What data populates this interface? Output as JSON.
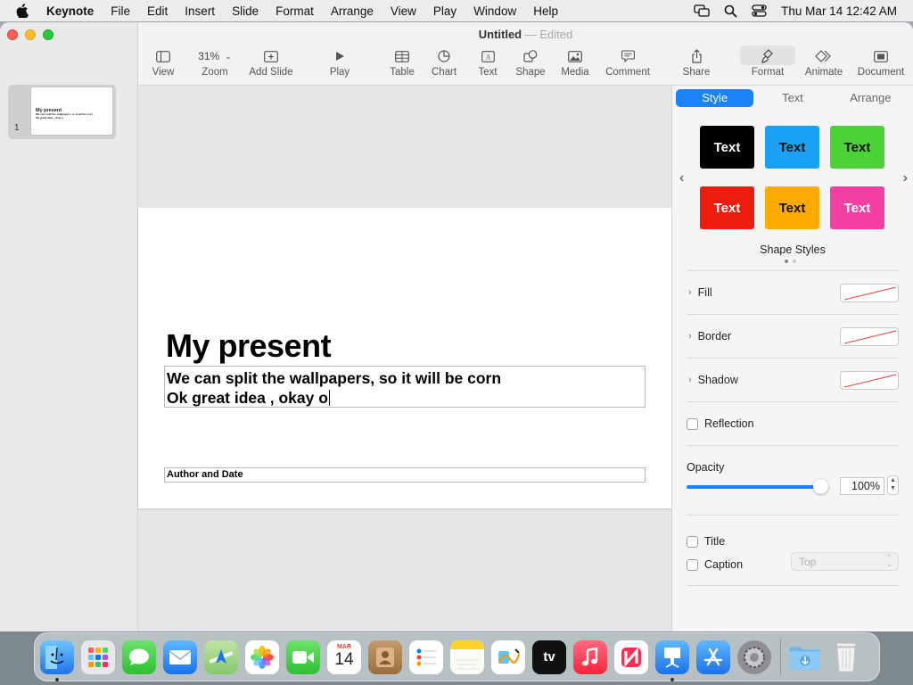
{
  "menubar": {
    "items": [
      "Keynote",
      "File",
      "Edit",
      "Insert",
      "Slide",
      "Format",
      "Arrange",
      "View",
      "Play",
      "Window",
      "Help"
    ],
    "clock": "Thu Mar 14  12:42 AM"
  },
  "window": {
    "title": "Untitled",
    "title_sep": "—",
    "status": "Edited"
  },
  "toolbar": {
    "zoom_value": "31%",
    "items": [
      "View",
      "Zoom",
      "Add Slide",
      "Play",
      "Table",
      "Chart",
      "Text",
      "Shape",
      "Media",
      "Comment",
      "Share",
      "Format",
      "Animate",
      "Document"
    ]
  },
  "navigator": {
    "slide_number": "1",
    "thumb_title": "My present",
    "thumb_line1": "We can split the wallpapers, so it will be corn",
    "thumb_line2": "Ok great idea , okay o"
  },
  "slide": {
    "title": "My present",
    "body_line1": "We can split the wallpapers, so it will be corn",
    "body_line2": "Ok great idea , okay o",
    "author": "Author and Date"
  },
  "inspector": {
    "tabs": [
      "Style",
      "Text",
      "Arrange"
    ],
    "active_tab": "Style",
    "shape_styles": [
      {
        "label": "Text",
        "bg": "#000000",
        "fg": "#ffffff"
      },
      {
        "label": "Text",
        "bg": "#1aa1f5",
        "fg": "#111111"
      },
      {
        "label": "Text",
        "bg": "#4cd137",
        "fg": "#111111"
      },
      {
        "label": "Text",
        "bg": "#ec1d0c",
        "fg": "#ffffff"
      },
      {
        "label": "Text",
        "bg": "#ffaa00",
        "fg": "#111111"
      },
      {
        "label": "Text",
        "bg": "#f43fa2",
        "fg": "#ffffff"
      }
    ],
    "shape_styles_label": "Shape Styles",
    "fill_label": "Fill",
    "border_label": "Border",
    "shadow_label": "Shadow",
    "reflection_label": "Reflection",
    "opacity_label": "Opacity",
    "opacity_value": "100%",
    "opacity_level": 1.0,
    "title_label": "Title",
    "title_position": "Top",
    "caption_label": "Caption"
  },
  "dock": {
    "apps": [
      "Finder",
      "Launchpad",
      "Messages",
      "Mail",
      "Maps",
      "Photos",
      "FaceTime",
      "Calendar",
      "Contacts",
      "Reminders",
      "Notes",
      "Freeform",
      "TV",
      "Music",
      "News",
      "Keynote",
      "App Store",
      "System Settings",
      "Downloads",
      "Trash"
    ],
    "calendar_month": "MAR",
    "calendar_day": "14",
    "tv_label": "tv"
  },
  "colors": {
    "accent": "#1a82fb",
    "close": "#fe5f57",
    "minimize": "#febc2e",
    "maximize": "#28c840"
  }
}
